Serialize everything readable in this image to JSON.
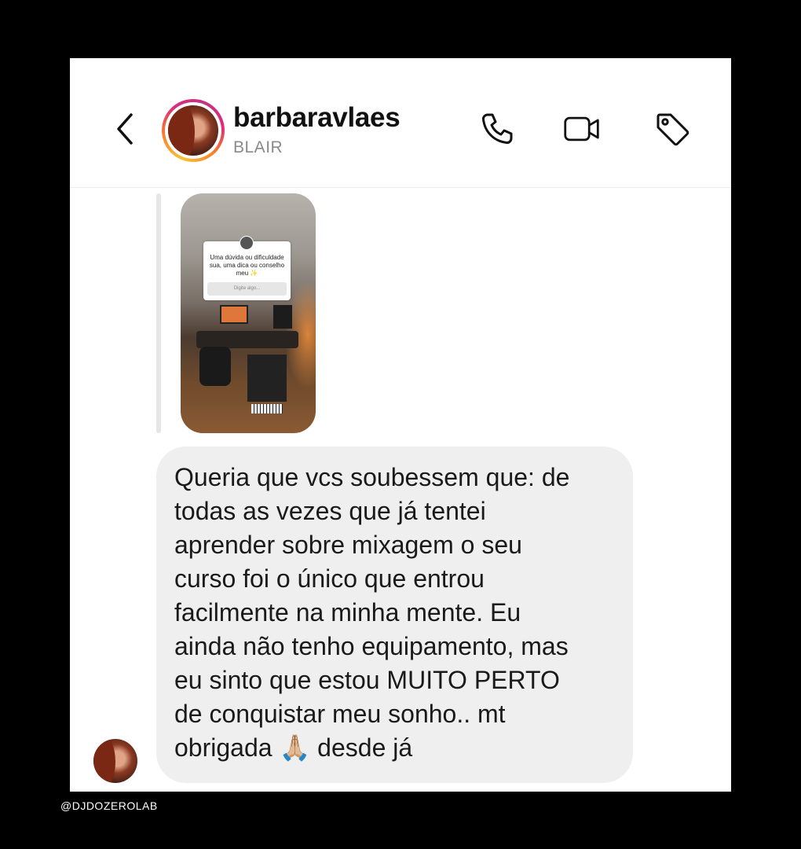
{
  "header": {
    "username": "barbaravlaes",
    "subname": "BLAIR",
    "icons": {
      "back": "chevron-left-icon",
      "call": "phone-icon",
      "video": "video-camera-icon",
      "tag": "tag-icon"
    }
  },
  "story_reply": {
    "question": "Uma dúvida ou dificuldade sua, uma dica ou conselho meu",
    "question_emoji": "✨",
    "input_placeholder": "Digite algo..."
  },
  "message": {
    "text": "Queria que vcs soubessem que: de\ntodas as vezes que já tentei\naprender sobre mixagem o seu\ncurso foi o único que entrou\nfacilmente na minha mente. Eu\nainda não tenho equipamento, mas\neu sinto que estou MUITO PERTO\nde conquistar meu sonho.. mt\nobrigada 🙏🏼 desde já"
  },
  "watermark": "@DJDOZEROLAB",
  "colors": {
    "background": "#000000",
    "bubble": "#efeff0",
    "ring_gradient": [
      "#f9c23c",
      "#f58529",
      "#dd2a7b",
      "#c13584"
    ]
  }
}
